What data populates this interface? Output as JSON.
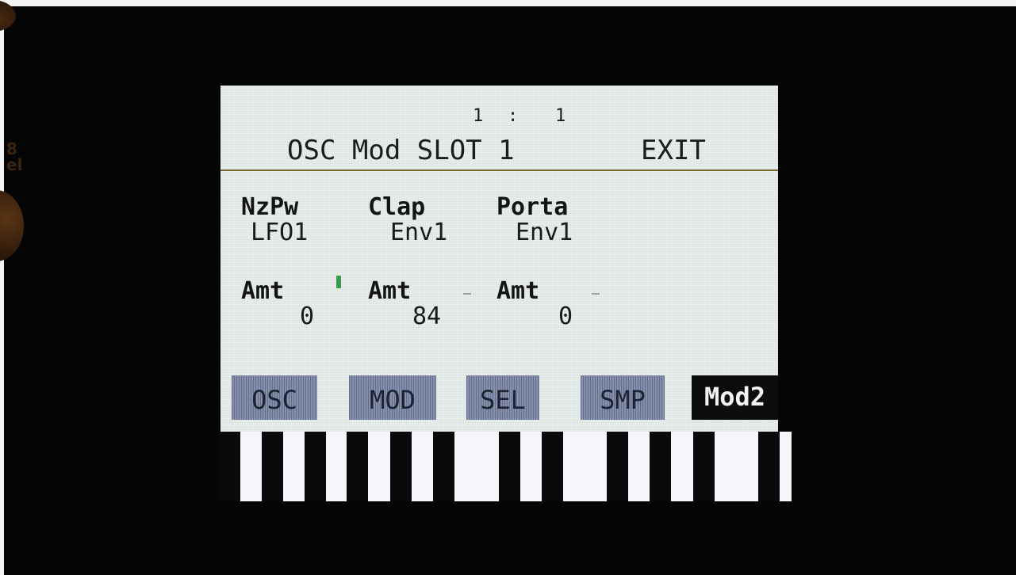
{
  "header": {
    "position_a": "1",
    "position_sep": ":",
    "position_b": "1",
    "title": "OSC Mod SLOT 1",
    "exit_label": "EXIT"
  },
  "slots": [
    {
      "name": "NzPw",
      "source": "LFO1",
      "amt_label": "Amt",
      "amt_value": "0"
    },
    {
      "name": "Clap",
      "source": "Env1",
      "amt_label": "Amt",
      "amt_value": "84"
    },
    {
      "name": "Porta",
      "source": "Env1",
      "amt_label": "Amt",
      "amt_value": "0"
    }
  ],
  "tabs": [
    {
      "label": "OSC",
      "active": false
    },
    {
      "label": "MOD",
      "active": false
    },
    {
      "label": "SEL",
      "active": false
    },
    {
      "label": "SMP",
      "active": false
    },
    {
      "label": "Mod2",
      "active": true
    }
  ],
  "colors": {
    "screen_bg": "#e7eeec",
    "tab_bg": "#8590ad",
    "tab_active_bg": "#0d0d0d",
    "meter": "#3d9a4b"
  },
  "side_label": "8\nel"
}
